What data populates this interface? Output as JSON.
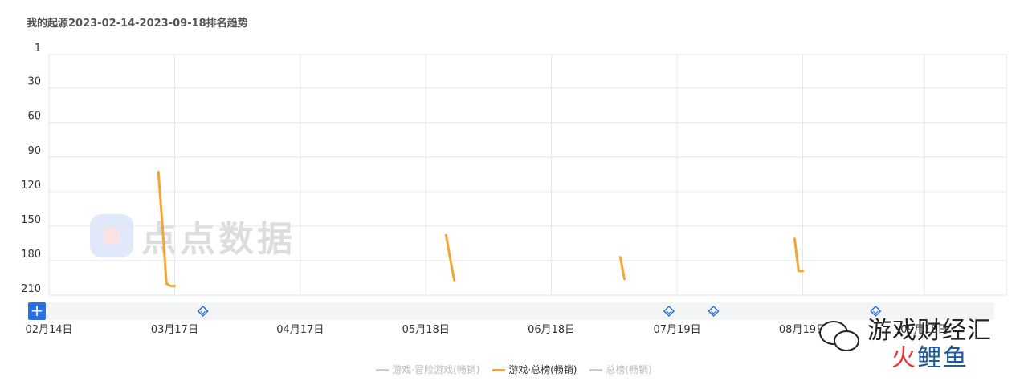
{
  "chart_data": {
    "type": "line",
    "title": "我的起源2023-02-14-2023-09-18排名趋势",
    "y_axis": {
      "inverted": true,
      "ticks": [
        1,
        30,
        60,
        90,
        120,
        150,
        180,
        210
      ],
      "range": [
        1,
        210
      ]
    },
    "x_axis": {
      "range": [
        "2023-02-14",
        "2023-09-18"
      ],
      "tick_dates": [
        "2023-02-14",
        "2023-03-17",
        "2023-04-17",
        "2023-05-18",
        "2023-06-18",
        "2023-07-19",
        "2023-08-19",
        "2023-09-18"
      ],
      "tick_labels": [
        "02月14日",
        "03月17日",
        "04月17日",
        "05月18日",
        "06月18日",
        "07月19日",
        "08月19日",
        "09月18日"
      ]
    },
    "grid": true,
    "legend_position": "bottom-center",
    "series": [
      {
        "name": "游戏·冒险游戏(畅销)",
        "color": "#cccccc",
        "visible": false,
        "segments": []
      },
      {
        "name": "游戏·总榜(畅销)",
        "color": "#f4a532",
        "visible": true,
        "segments": [
          [
            [
              "2023-03-13",
              103
            ],
            [
              "2023-03-14",
              150
            ],
            [
              "2023-03-15",
              200
            ],
            [
              "2023-03-16",
              202
            ],
            [
              "2023-03-17",
              202
            ]
          ],
          [
            [
              "2023-05-23",
              158
            ],
            [
              "2023-05-24",
              178
            ],
            [
              "2023-05-25",
              197
            ]
          ],
          [
            [
              "2023-07-05",
              177
            ],
            [
              "2023-07-06",
              196
            ]
          ],
          [
            [
              "2023-08-17",
              161
            ],
            [
              "2023-08-18",
              189
            ],
            [
              "2023-08-19",
              189
            ]
          ]
        ]
      },
      {
        "name": "总榜(畅销)",
        "color": "#cccccc",
        "visible": false,
        "segments": []
      }
    ],
    "event_markers": [
      "2023-03-24",
      "2023-07-17",
      "2023-07-28",
      "2023-09-06"
    ]
  },
  "watermark": {
    "text": "点点数据",
    "logo_color": "#4a78e0"
  },
  "corner_watermark": {
    "text": "游戏财经汇",
    "brand_fire": "火",
    "brand_rest": "鲤鱼"
  },
  "controls": {
    "add_label": "+"
  }
}
